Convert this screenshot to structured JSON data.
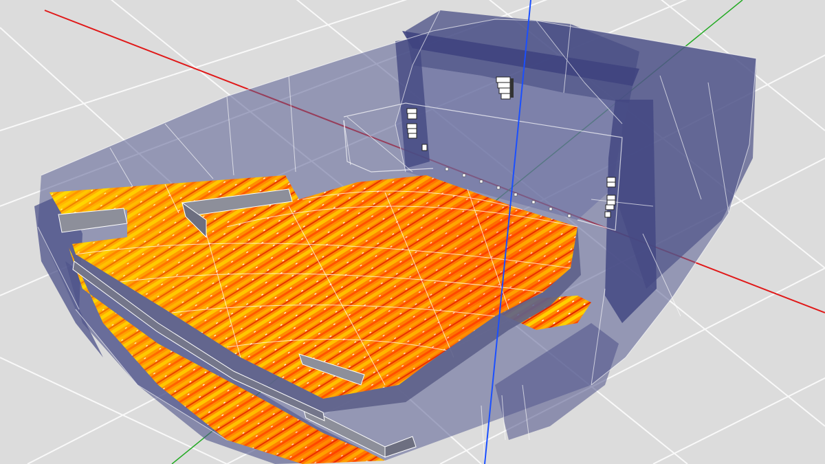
{
  "scene": {
    "background": "#dcdcdc",
    "grid_color": "#ffffff",
    "axis_colors": {
      "x": "#e01818",
      "y": "#22aa22",
      "z": "#1a4fff"
    },
    "venue_shell_color": "#5a5f94",
    "wall_edge_color": "#ffffff",
    "balcony_front_color": "#8d8f9a",
    "heatmap_colors": [
      "#ffe000",
      "#ffae00",
      "#ff7a00",
      "#ff4a00",
      "#d81a00"
    ],
    "speakers": [
      {
        "name": "center-line-array",
        "icon": "line-array-icon"
      },
      {
        "name": "left-line-array",
        "icon": "line-array-icon"
      },
      {
        "name": "right-line-array",
        "icon": "line-array-icon"
      }
    ]
  }
}
